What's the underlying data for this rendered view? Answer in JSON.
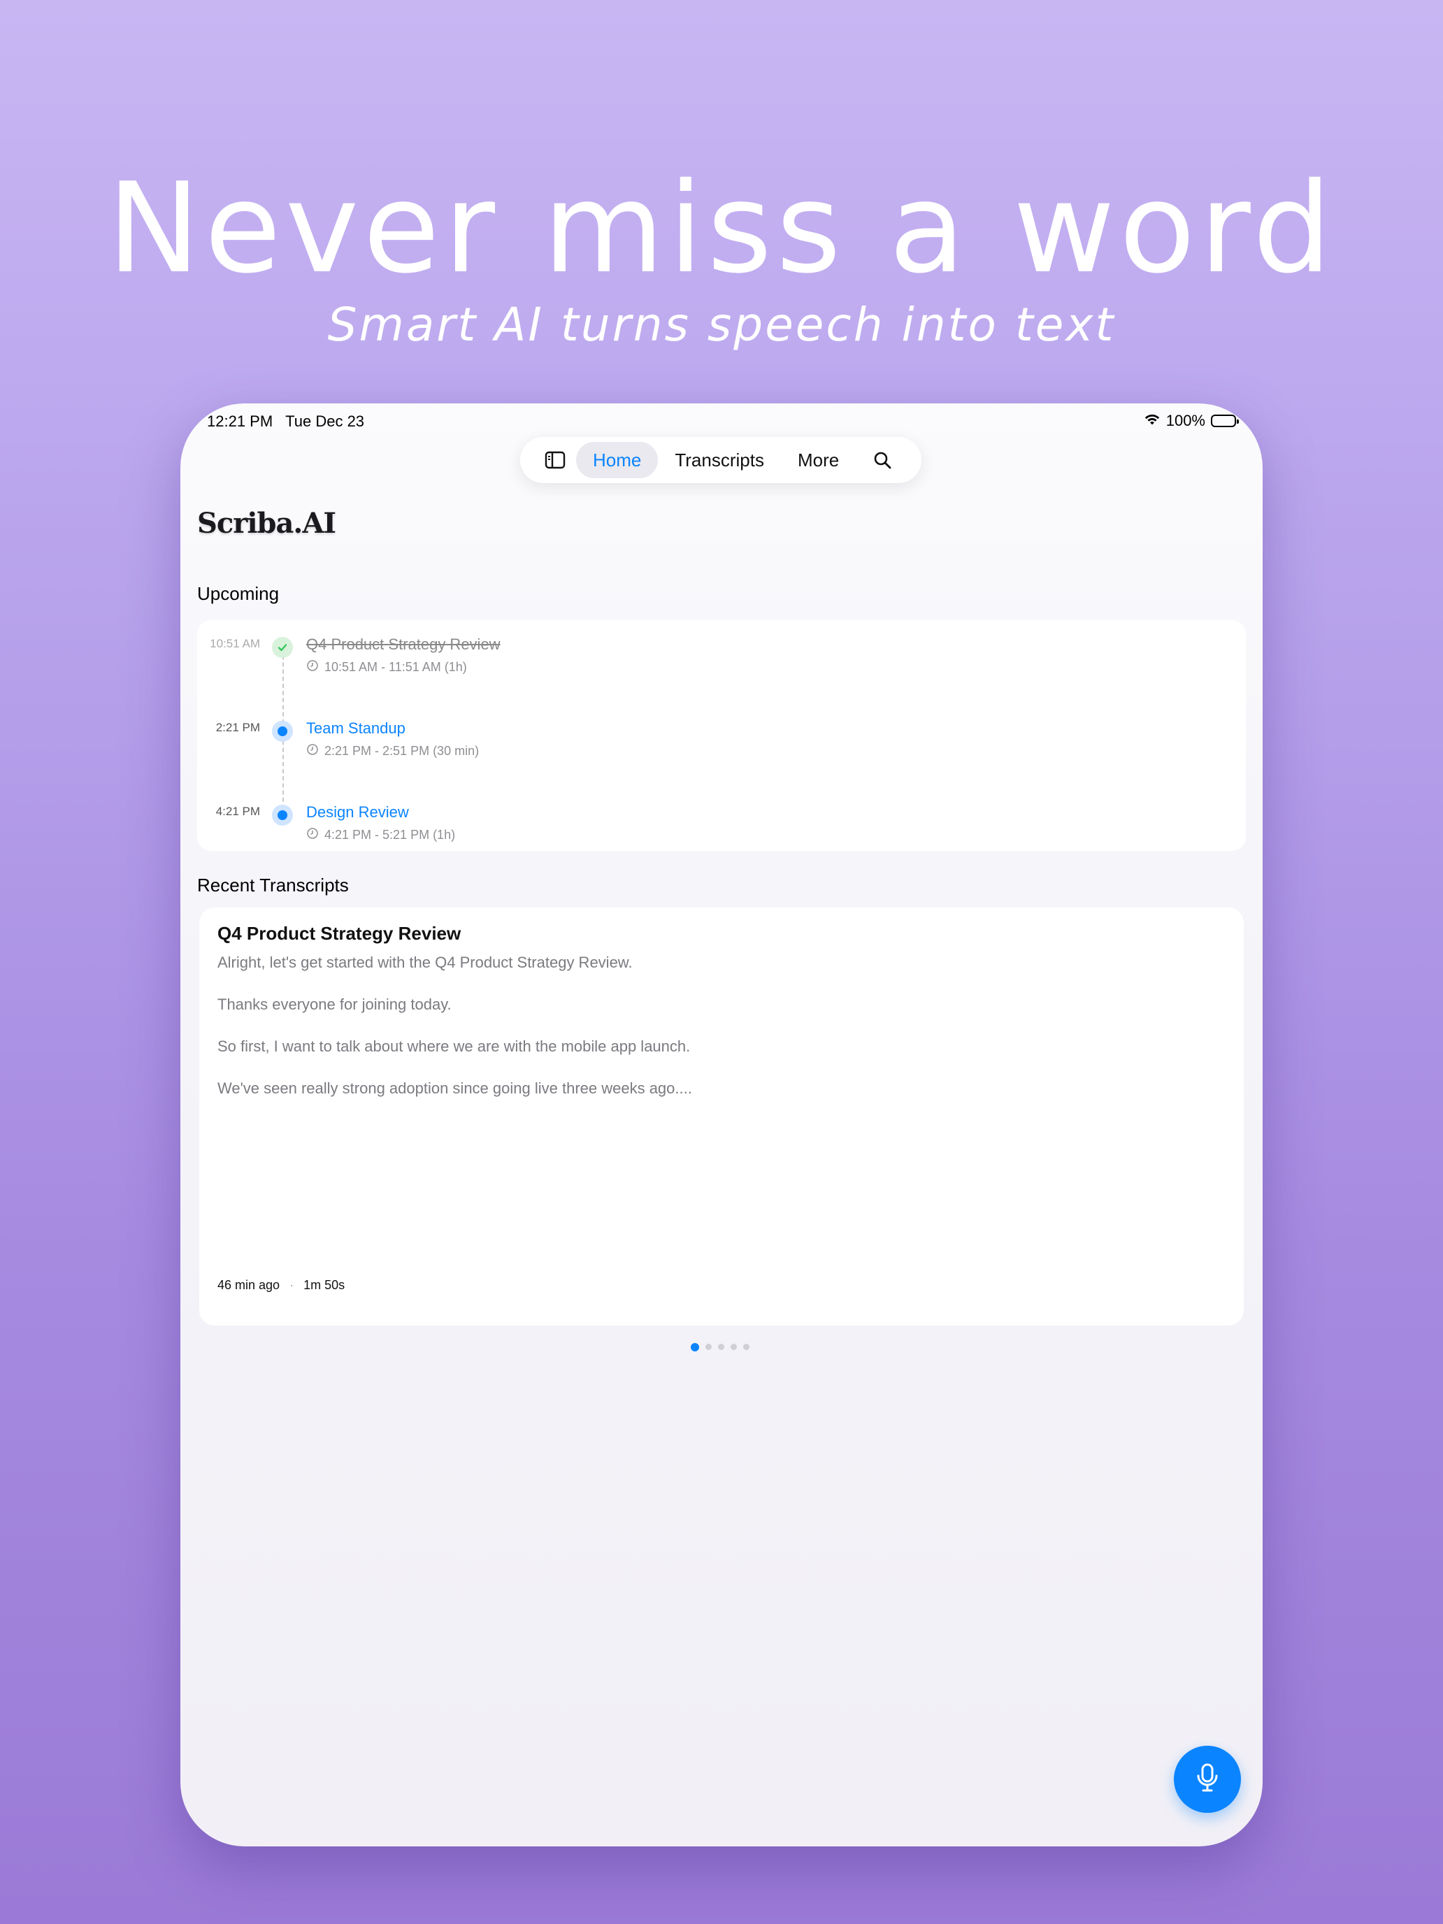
{
  "hero": {
    "headline": "Never miss a word",
    "subheadline": "Smart AI turns speech into text"
  },
  "status_bar": {
    "time": "12:21 PM",
    "date": "Tue Dec 23",
    "battery": "100%"
  },
  "nav": {
    "sidebar_icon": "sidebar-icon",
    "tabs": [
      {
        "label": "Home",
        "active": true
      },
      {
        "label": "Transcripts",
        "active": false
      },
      {
        "label": "More",
        "active": false
      }
    ],
    "search_icon": "search-icon"
  },
  "app": {
    "brand": "Scriba.AI"
  },
  "upcoming": {
    "title": "Upcoming",
    "events": [
      {
        "time": "10:51 AM",
        "title": "Q4 Product Strategy Review",
        "range": "10:51 AM - 11:51 AM (1h)",
        "status": "done"
      },
      {
        "time": "2:21 PM",
        "title": "Team Standup",
        "range": "2:21 PM - 2:51 PM (30 min)",
        "status": "upcoming"
      },
      {
        "time": "4:21 PM",
        "title": "Design Review",
        "range": "4:21 PM - 5:21 PM (1h)",
        "status": "upcoming"
      }
    ]
  },
  "recent": {
    "title": "Recent Transcripts",
    "card": {
      "title": "Q4 Product Strategy Review",
      "paragraphs": [
        "Alright, let's get started with the Q4 Product Strategy Review.",
        "Thanks everyone for joining today.",
        "So first, I want to talk about where we are with the mobile app launch.",
        "We've seen really strong adoption since going live three weeks ago...."
      ],
      "age": "46 min ago",
      "duration": "1m 50s"
    },
    "pagination": {
      "count": 5,
      "active": 1
    }
  },
  "colors": {
    "accent": "#0a84ff",
    "done_green": "#34c759",
    "bg_top": "#c8b6f3",
    "bg_bottom": "#9a7ad6"
  },
  "fab": {
    "icon": "microphone-icon"
  }
}
